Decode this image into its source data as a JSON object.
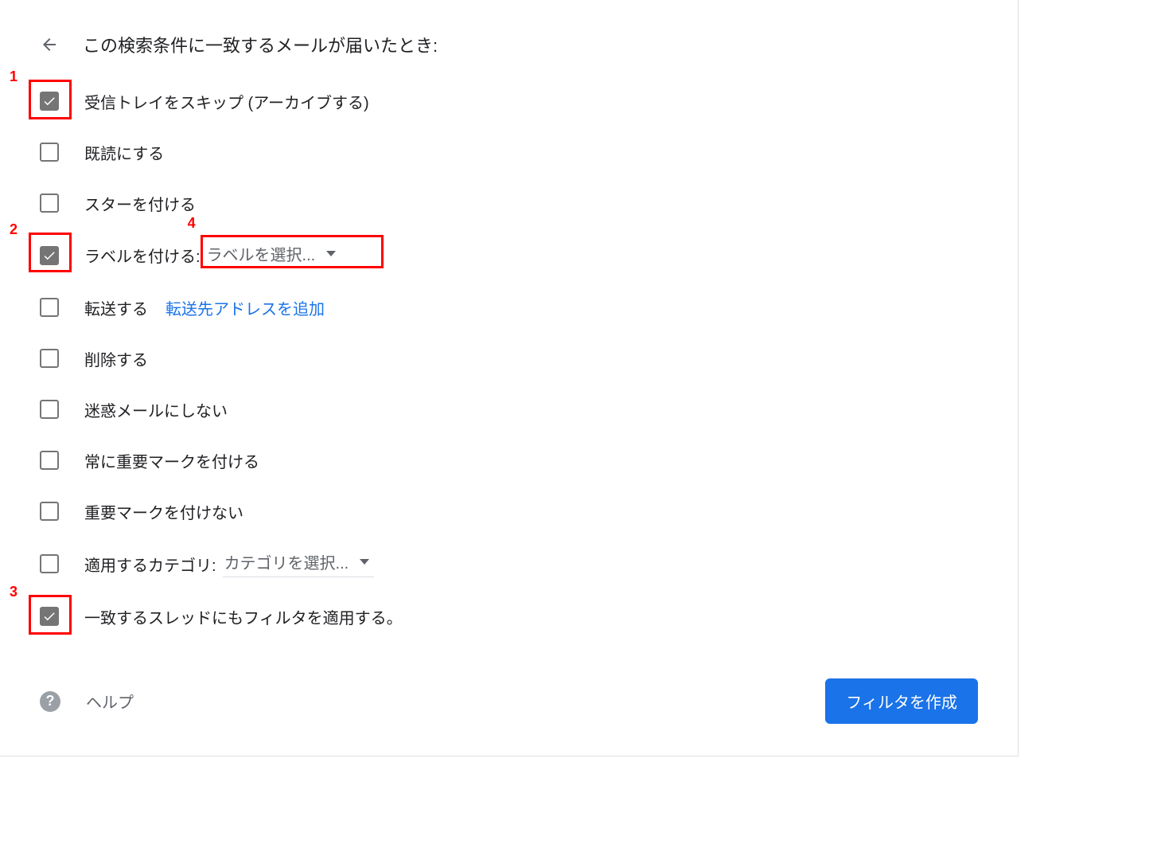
{
  "header": {
    "title": "この検索条件に一致するメールが届いたとき:"
  },
  "options": {
    "skip_inbox": {
      "label": "受信トレイをスキップ (アーカイブする)",
      "checked": true
    },
    "mark_read": {
      "label": "既読にする",
      "checked": false
    },
    "star": {
      "label": "スターを付ける",
      "checked": false
    },
    "apply_label": {
      "label": "ラベルを付ける:",
      "checked": true,
      "dropdown": "ラベルを選択..."
    },
    "forward": {
      "label": "転送する",
      "checked": false,
      "link": "転送先アドレスを追加"
    },
    "delete": {
      "label": "削除する",
      "checked": false
    },
    "never_spam": {
      "label": "迷惑メールにしない",
      "checked": false
    },
    "always_important": {
      "label": "常に重要マークを付ける",
      "checked": false
    },
    "never_important": {
      "label": "重要マークを付けない",
      "checked": false
    },
    "category": {
      "label": "適用するカテゴリ:",
      "checked": false,
      "dropdown": "カテゴリを選択..."
    },
    "apply_existing": {
      "label": "一致するスレッドにもフィルタを適用する。",
      "checked": true
    }
  },
  "footer": {
    "help": "ヘルプ",
    "create": "フィルタを作成"
  },
  "annotations": {
    "a1": "1",
    "a2": "2",
    "a3": "3",
    "a4": "4"
  }
}
